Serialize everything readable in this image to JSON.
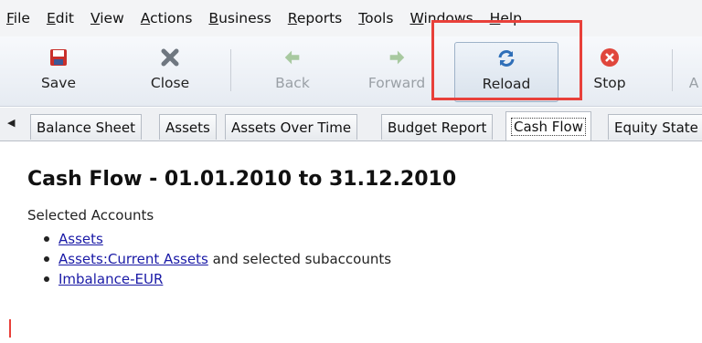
{
  "menu": [
    {
      "mnemonic": "F",
      "rest": "ile"
    },
    {
      "mnemonic": "E",
      "rest": "dit"
    },
    {
      "mnemonic": "V",
      "rest": "iew"
    },
    {
      "mnemonic": "A",
      "rest": "ctions"
    },
    {
      "mnemonic": "B",
      "rest": "usiness"
    },
    {
      "mnemonic": "R",
      "rest": "eports"
    },
    {
      "mnemonic": "T",
      "rest": "ools"
    },
    {
      "mnemonic": "W",
      "rest": "indows"
    },
    {
      "mnemonic": "H",
      "rest": "elp"
    }
  ],
  "toolbar": {
    "save": "Save",
    "close": "Close",
    "back": "Back",
    "forward": "Forward",
    "reload": "Reload",
    "stop": "Stop",
    "partial": "A"
  },
  "tabs": [
    "Balance Sheet",
    "Assets",
    "Assets Over Time",
    "Budget Report",
    "Cash Flow",
    "Equity State"
  ],
  "report": {
    "title": "Cash Flow - 01.01.2010 to 31.12.2010",
    "subtitle": "Selected Accounts",
    "accounts": [
      {
        "link": "Assets",
        "suffix": ""
      },
      {
        "link": "Assets:Current Assets",
        "suffix": " and selected subaccounts"
      },
      {
        "link": "Imbalance-EUR",
        "suffix": ""
      }
    ]
  },
  "colors": {
    "highlight": "#e8403a",
    "link": "#1a1aa6"
  }
}
